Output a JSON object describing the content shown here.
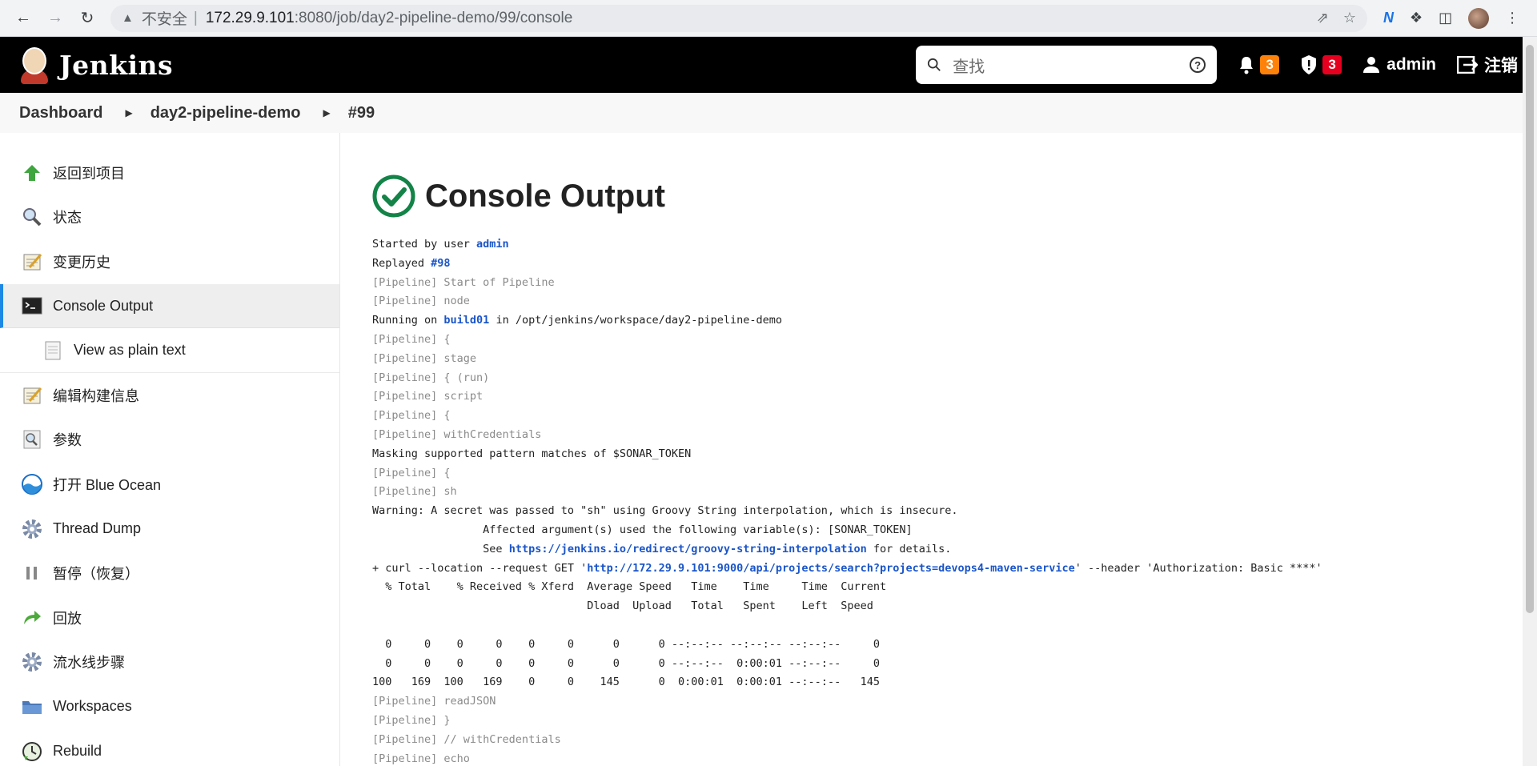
{
  "browser": {
    "insecure_label": "不安全",
    "url_host": "172.29.9.101",
    "url_rest": ":8080/job/day2-pipeline-demo/99/console"
  },
  "header": {
    "title": "Jenkins",
    "search_placeholder": "查找",
    "notifications_count": "3",
    "security_count": "3",
    "user": "admin",
    "logout": "注销"
  },
  "breadcrumbs": [
    "Dashboard",
    "day2-pipeline-demo",
    "#99"
  ],
  "sidebar": {
    "items": [
      {
        "label": "返回到项目",
        "icon": "up-arrow-icon"
      },
      {
        "label": "状态",
        "icon": "magnifier-icon"
      },
      {
        "label": "变更历史",
        "icon": "notepad-icon"
      },
      {
        "label": "Console Output",
        "icon": "terminal-icon"
      },
      {
        "label": "View as plain text",
        "icon": "document-icon"
      },
      {
        "label": "编辑构建信息",
        "icon": "notepad-icon"
      },
      {
        "label": "参数",
        "icon": "search-doc-icon"
      },
      {
        "label": "打开 Blue Ocean",
        "icon": "blue-ocean-icon"
      },
      {
        "label": "Thread Dump",
        "icon": "gear-icon"
      },
      {
        "label": "暂停（恢复）",
        "icon": "pause-icon"
      },
      {
        "label": "回放",
        "icon": "replay-arrow-icon"
      },
      {
        "label": "流水线步骤",
        "icon": "gear-icon"
      },
      {
        "label": "Workspaces",
        "icon": "folder-icon"
      },
      {
        "label": "Rebuild",
        "icon": "clock-icon"
      }
    ]
  },
  "main": {
    "title": "Console Output",
    "status_color": "#138347",
    "lines": {
      "l1a": "Started by user ",
      "l1b": "admin",
      "l2a": "Replayed ",
      "l2b": "#98",
      "l3": "[Pipeline] Start of Pipeline",
      "l4": "[Pipeline] node",
      "l5a": "Running on ",
      "l5b": "build01",
      "l5c": " in /opt/jenkins/workspace/day2-pipeline-demo",
      "l6": "[Pipeline] {",
      "l7": "[Pipeline] stage",
      "l8": "[Pipeline] { (run)",
      "l9": "[Pipeline] script",
      "l10": "[Pipeline] {",
      "l11": "[Pipeline] withCredentials",
      "l12": "Masking supported pattern matches of $SONAR_TOKEN",
      "l13": "[Pipeline] {",
      "l14": "[Pipeline] sh",
      "l15": "Warning: A secret was passed to \"sh\" using Groovy String interpolation, which is insecure.",
      "l16": "\t\t Affected argument(s) used the following variable(s): [SONAR_TOKEN]",
      "l17a": "\t\t See ",
      "l17b": "https://jenkins.io/redirect/groovy-string-interpolation",
      "l17c": " for details.",
      "l18a": "+ curl --location --request GET '",
      "l18b": "http://172.29.9.101:9000/api/projects/search?projects=devops4-maven-service",
      "l18c": "' --header 'Authorization: Basic ****'",
      "l19": "  % Total    % Received % Xferd  Average Speed   Time    Time     Time  Current",
      "l20": "                                 Dload  Upload   Total   Spent    Left  Speed",
      "l21": "",
      "l22": "  0     0    0     0    0     0      0      0 --:--:-- --:--:-- --:--:--     0",
      "l23": "  0     0    0     0    0     0      0      0 --:--:--  0:00:01 --:--:--     0",
      "l24": "100   169  100   169    0     0    145      0  0:00:01  0:00:01 --:--:--   145",
      "l25": "[Pipeline] readJSON",
      "l26": "[Pipeline] }",
      "l27": "[Pipeline] // withCredentials",
      "l28": "[Pipeline] echo"
    }
  }
}
